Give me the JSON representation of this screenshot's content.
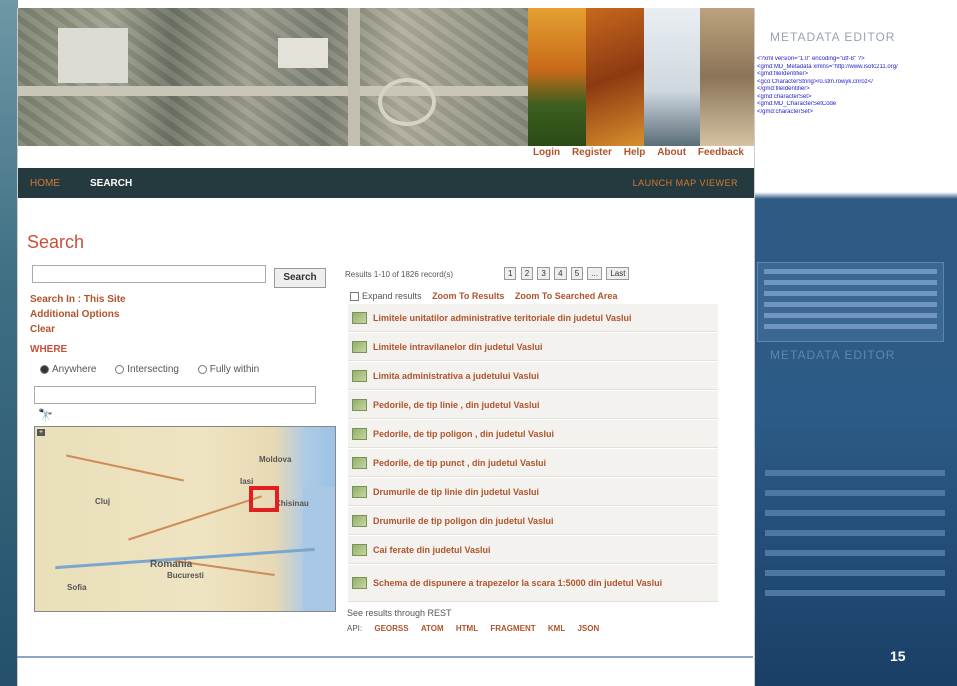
{
  "slide": {
    "right_panel": {
      "metadata_title": "METADATA EDITOR",
      "xml_lines": [
        "<?xml version=\"1.0\" encoding=\"utf-8\" ?>",
        "<gmd:MD_Metadata xmlns=\"http://www.isotc211.org/",
        "<gmd:fileIdentifier>",
        "<gco:CharacterString>ro.stm.rowyk.cnroz</",
        "</gmd:fileIdentifier>",
        "<gmd:characterSet>",
        "<gmd:MD_CharacterSetCode",
        "</gmd:characterSet>"
      ],
      "metadata_title_2": "METADATA EDITOR"
    },
    "page_number": "15"
  },
  "app": {
    "top_nav": [
      "Login",
      "Register",
      "Help",
      "About",
      "Feedback"
    ],
    "main_nav": {
      "home": "HOME",
      "search": "SEARCH",
      "right": "LAUNCH MAP VIEWER"
    },
    "heading": "Search",
    "search_input_value": "",
    "search_button": "Search",
    "links": {
      "search_in": "Search In : This Site",
      "additional_options": "Additional Options",
      "clear": "Clear",
      "where": "WHERE"
    },
    "where_options": [
      {
        "label": "Anywhere",
        "selected": true
      },
      {
        "label": "Intersecting",
        "selected": false
      },
      {
        "label": "Fully within",
        "selected": false
      }
    ],
    "place_input_value": "",
    "map": {
      "labels": [
        "Moldova",
        "Chisinau",
        "Romania",
        "Bucuresti",
        "Sofia",
        "Iasi",
        "Cluj"
      ],
      "zoom_label": "+"
    },
    "results": {
      "count_text": "Results 1-10 of 1826 record(s)",
      "pager": [
        "1",
        "2",
        "3",
        "4",
        "5",
        "...",
        "Last"
      ],
      "expand_label": "Expand results",
      "zoom_to_results": "Zoom To Results",
      "zoom_to_area": "Zoom To Searched Area",
      "items": [
        "Limitele unitatilor administrative teritoriale din judetul Vaslui",
        "Limitele intravilanelor din judetul Vaslui",
        "Limita administrativa a judetului Vaslui",
        "Pedorile, de tip linie , din judetul Vaslui",
        "Pedorile, de tip poligon , din judetul Vaslui",
        "Pedorile, de tip punct , din judetul Vaslui",
        "Drumurile de tip linie din judetul Vaslui",
        "Drumurile de tip poligon din judetul Vaslui",
        "Cai ferate din judetul Vaslui",
        "Schema de dispunere a trapezelor la scara 1:5000 din judetul Vaslui"
      ],
      "via_text": "See results through REST",
      "api_label": "API:",
      "formats": [
        "GEORSS",
        "ATOM",
        "HTML",
        "FRAGMENT",
        "KML",
        "JSON"
      ]
    }
  }
}
